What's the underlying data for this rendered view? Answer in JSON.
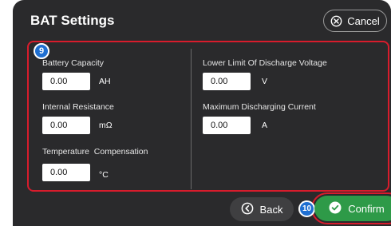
{
  "header": {
    "title": "BAT Settings",
    "cancel_label": "Cancel"
  },
  "panel": {
    "badge": "9",
    "fields": [
      {
        "label": "Battery Capacity",
        "value": "0.00",
        "unit": "AH"
      },
      {
        "label": "Internal Resistance",
        "value": "0.00",
        "unit": "mΩ"
      },
      {
        "label": "Temperature  Compensation",
        "value": "0.00",
        "unit": "°C"
      },
      {
        "label": "Lower Limit Of Discharge Voltage",
        "value": "0.00",
        "unit": "V"
      },
      {
        "label": "Maximum Discharging Current",
        "value": "0.00",
        "unit": "A"
      }
    ]
  },
  "footer": {
    "back_label": "Back",
    "confirm_label": "Confirm",
    "confirm_badge": "10"
  },
  "colors": {
    "background": "#2a2a2c",
    "highlight": "#d81c2c",
    "badge": "#1f6fd1",
    "confirm": "#2e9a48"
  },
  "icons": {
    "cancel": "close-circle-icon",
    "back": "back-circle-icon",
    "confirm": "check-circle-icon"
  }
}
